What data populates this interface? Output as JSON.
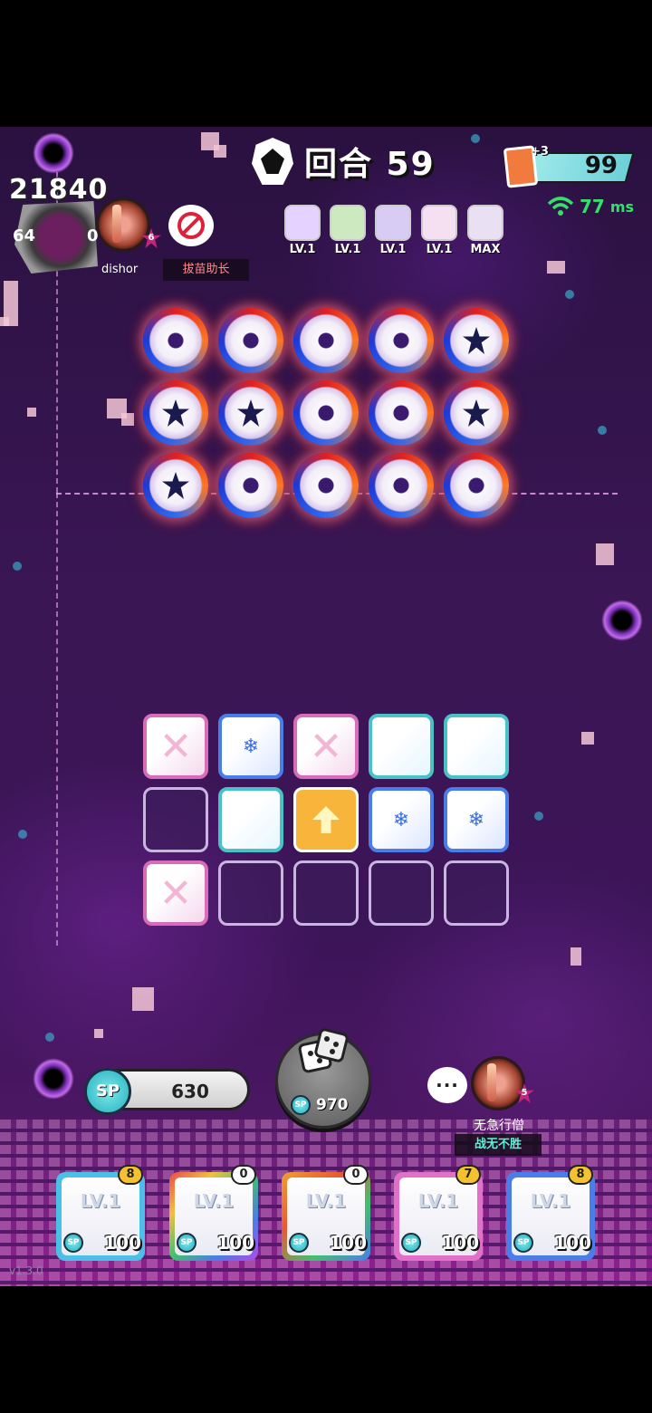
{
  "hud": {
    "score": "21840",
    "side_left": "64",
    "side_right": "0",
    "player_name": "dishor",
    "player_rank": "6",
    "banned_label": "拔苗助长",
    "round_text": "回合 59",
    "card_plus": "+3",
    "card_count": "99",
    "ping_value": "77",
    "ping_unit": "ms"
  },
  "enemy_deck": [
    {
      "level": "LV.1",
      "color": "#e6d2ff"
    },
    {
      "level": "LV.1",
      "color": "#cde9c0"
    },
    {
      "level": "LV.1",
      "color": "#d8ccf4"
    },
    {
      "level": "LV.1",
      "color": "#f4e0f0"
    },
    {
      "level": "MAX",
      "color": "#e9e0f4"
    }
  ],
  "controls": {
    "sp_label": "SP",
    "sp_value": "630",
    "roll_cost_label": "SP",
    "roll_cost": "970",
    "chat_icon": "ellipsis-icon"
  },
  "opponent": {
    "name": "无急行僧",
    "title": "战无不胜",
    "rank": "5"
  },
  "deck": [
    {
      "level": "LV.1",
      "count": "8",
      "cost_label": "SP",
      "cost": "100",
      "frame": "#4ac0e8",
      "gold": true
    },
    {
      "level": "LV.1",
      "count": "0",
      "cost_label": "SP",
      "cost": "100",
      "frame": "#e84a6a",
      "gold": false
    },
    {
      "level": "LV.1",
      "count": "0",
      "cost_label": "SP",
      "cost": "100",
      "frame": "#f0a030",
      "gold": false
    },
    {
      "level": "LV.1",
      "count": "7",
      "cost_label": "SP",
      "cost": "100",
      "frame": "#e070c8",
      "gold": true
    },
    {
      "level": "LV.1",
      "count": "8",
      "cost_label": "SP",
      "cost": "100",
      "frame": "#4a7de8",
      "gold": true
    }
  ],
  "version": "v1.3.0"
}
